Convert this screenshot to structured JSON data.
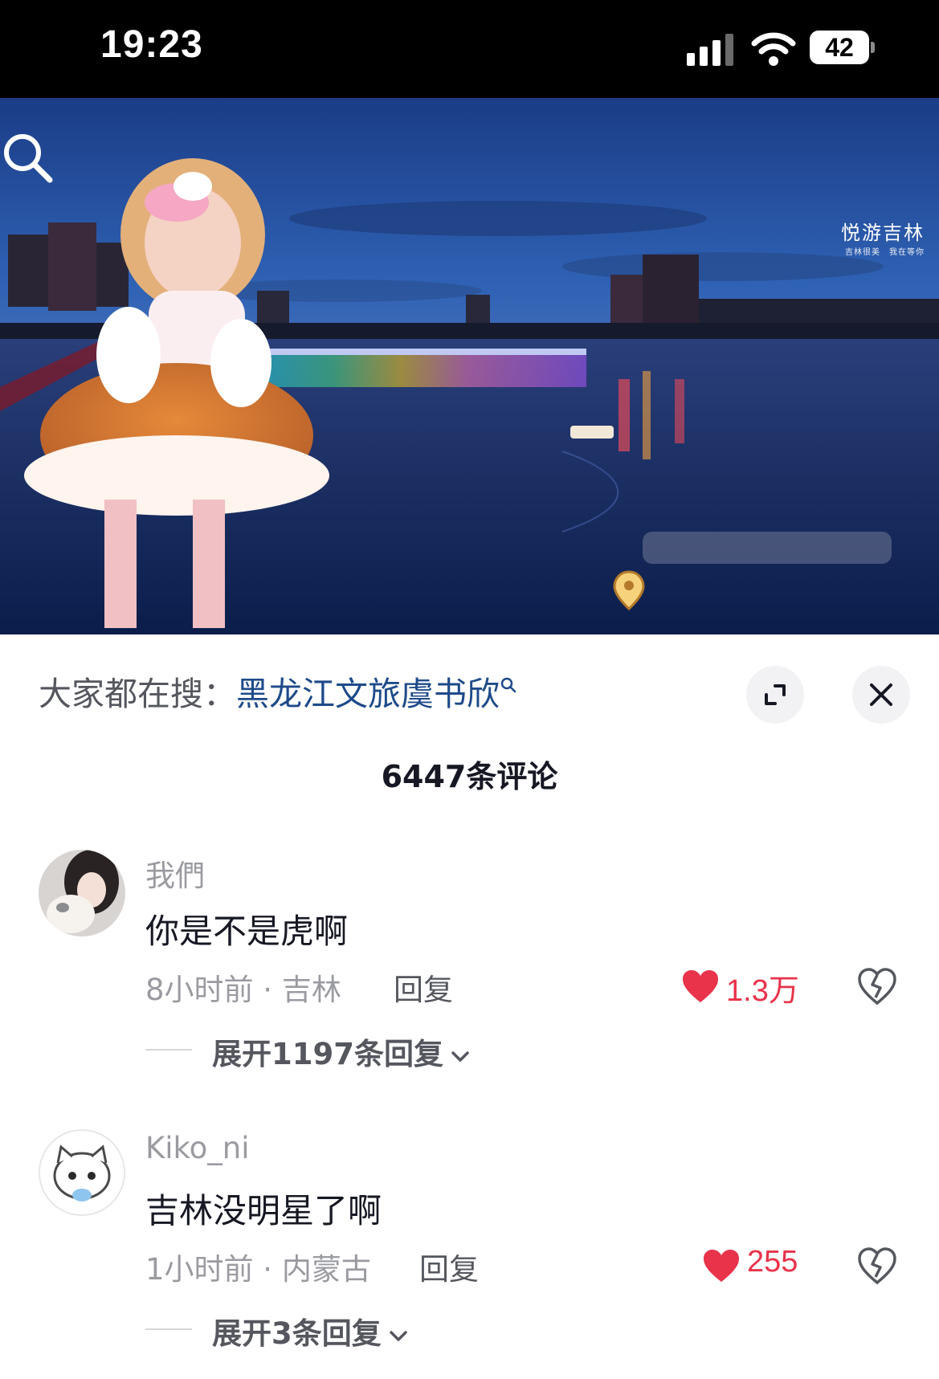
{
  "status_bar": {
    "time": "19:23",
    "battery": "42",
    "icons": [
      "signal-icon",
      "wifi-icon",
      "battery-icon"
    ]
  },
  "video": {
    "watermark_title": "悦游吉林",
    "watermark_sub_left": "吉林很美",
    "watermark_sub_right": "我在等你",
    "icons": [
      "search-icon",
      "location-pin-icon"
    ]
  },
  "panel": {
    "search_prefix": "大家都在搜：",
    "search_keyword": "黑龙江文旅虞书欣",
    "comment_count": "6447条评论",
    "icons": [
      "expand-icon",
      "close-icon"
    ]
  },
  "comments": [
    {
      "username": "我們",
      "text": "你是不是虎啊",
      "meta": "8小时前 · 吉林",
      "reply": "回复",
      "likes": "1.3万",
      "expand": "展开1197条回复"
    },
    {
      "username": "Kiko_ni",
      "text": "吉林没明星了啊",
      "meta": "1小时前 · 内蒙古",
      "reply": "回复",
      "likes": "255",
      "expand": "展开3条回复"
    }
  ],
  "colors": {
    "like": "#e8334b",
    "link": "#1e4a8a",
    "muted": "#9a9ba1",
    "text": "#161823"
  }
}
